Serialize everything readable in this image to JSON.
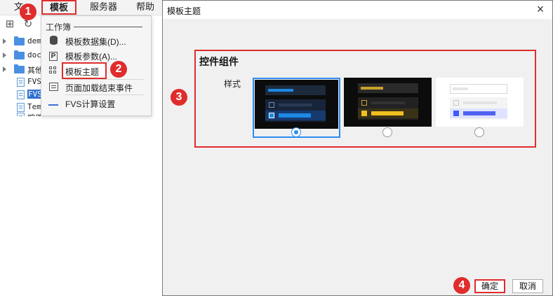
{
  "menubar": {
    "file": "文",
    "template": "模板",
    "server": "服务器",
    "help": "帮助"
  },
  "tree": {
    "rows": [
      {
        "label": "dem",
        "type": "folder"
      },
      {
        "label": "doc",
        "type": "folder"
      },
      {
        "label": "其他",
        "type": "folder"
      },
      {
        "label": "FVS",
        "type": "file"
      },
      {
        "label": "FVS",
        "type": "file",
        "selected": true
      },
      {
        "label": "Tem",
        "type": "file"
      },
      {
        "label": "控件",
        "type": "file"
      }
    ]
  },
  "dropdown": {
    "group": "工作簿",
    "items": [
      {
        "label": "模板数据集(D)...",
        "icon": "database-icon"
      },
      {
        "label": "模板参数(A)...",
        "icon": "parameter-icon"
      },
      {
        "label": "模板主题",
        "icon": "theme-grid-icon"
      },
      {
        "label": "页面加载结束事件",
        "icon": "event-icon"
      },
      {
        "label": "FVS计算设置",
        "icon": "line-icon"
      }
    ]
  },
  "badges": [
    "1",
    "2",
    "3",
    "4"
  ],
  "dialog": {
    "title": "模板主题",
    "section_title": "控件组件",
    "style_label": "样式",
    "options": [
      {
        "name": "dark-blue",
        "selected": true
      },
      {
        "name": "dark-gold",
        "selected": false
      },
      {
        "name": "light",
        "selected": false
      }
    ],
    "ok": "确定",
    "cancel": "取消"
  },
  "colors": {
    "highlight": "#e02c2c",
    "accent": "#2d8cf0",
    "dark_bg": "#0c0c0c",
    "gold": "#f0c020",
    "blue": "#1e88e5"
  }
}
